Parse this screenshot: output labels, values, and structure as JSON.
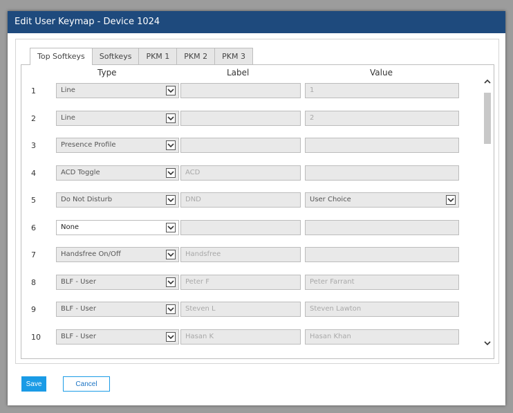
{
  "dialog": {
    "title": "Edit User Keymap - Device 1024",
    "tabs": [
      {
        "label": "Top Softkeys",
        "active": true
      },
      {
        "label": "Softkeys",
        "active": false
      },
      {
        "label": "PKM 1",
        "active": false
      },
      {
        "label": "PKM 2",
        "active": false
      },
      {
        "label": "PKM 3",
        "active": false
      }
    ],
    "columns": {
      "type": "Type",
      "label": "Label",
      "value": "Value"
    },
    "rows": [
      {
        "num": "1",
        "type": "Line",
        "label": "",
        "value": "1"
      },
      {
        "num": "2",
        "type": "Line",
        "label": "",
        "value": "2"
      },
      {
        "num": "3",
        "type": "Presence Profile",
        "label": "",
        "value": ""
      },
      {
        "num": "4",
        "type": "ACD Toggle",
        "label": "ACD",
        "value": ""
      },
      {
        "num": "5",
        "type": "Do Not Disturb",
        "label": "DND",
        "value": "User Choice"
      },
      {
        "num": "6",
        "type": "None",
        "label": "",
        "value": ""
      },
      {
        "num": "7",
        "type": "Handsfree On/Off",
        "label": "Handsfree",
        "value": ""
      },
      {
        "num": "8",
        "type": "BLF - User",
        "label": "Peter F",
        "value": "Peter Farrant"
      },
      {
        "num": "9",
        "type": "BLF - User",
        "label": "Steven L",
        "value": "Steven Lawton"
      },
      {
        "num": "10",
        "type": "BLF - User",
        "label": "Hasan K",
        "value": "Hasan Khan"
      }
    ],
    "buttons": {
      "save": "Save",
      "cancel": "Cancel"
    }
  },
  "colors": {
    "titlebar": "#1e4a7d",
    "save_button": "#1a9be6"
  }
}
